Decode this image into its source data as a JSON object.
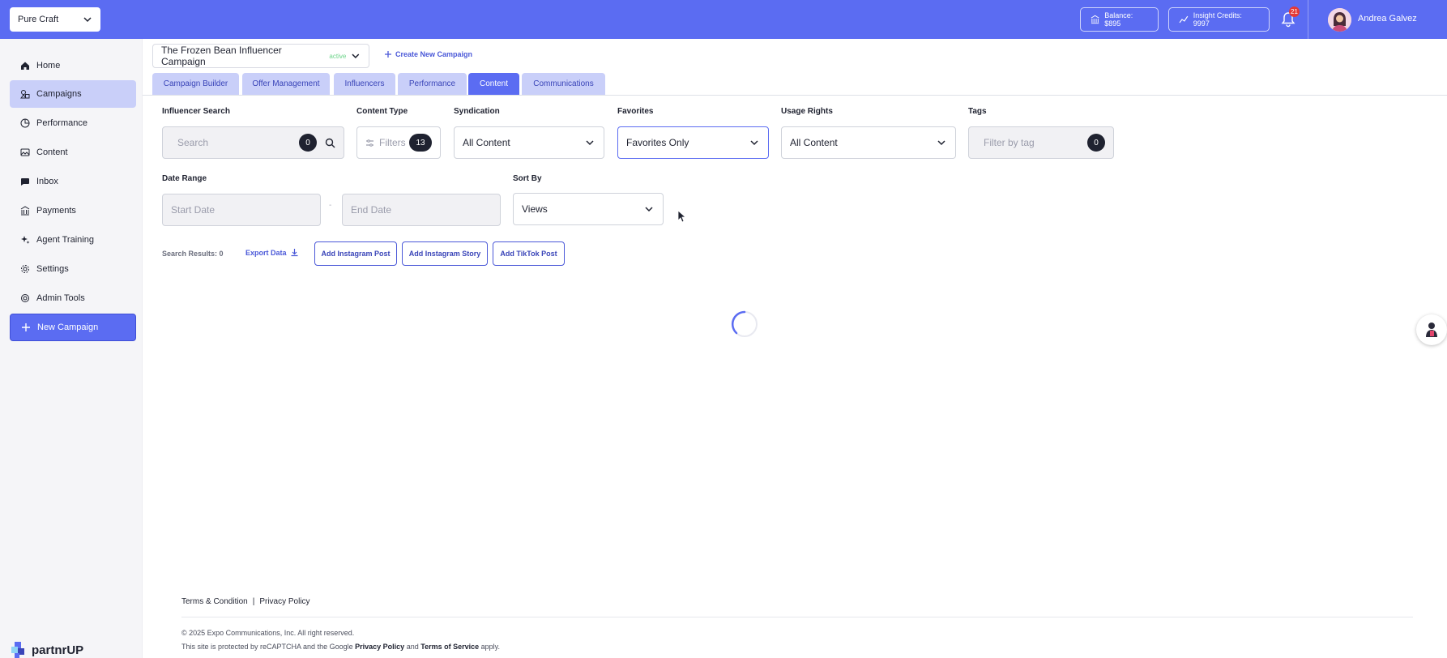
{
  "colors": {
    "primary": "#5b6cf2",
    "tab_inactive": "#c9cff9",
    "sidebar_bg": "#f5f5f8",
    "badge_red": "#e53935",
    "status_green": "#6cd48a"
  },
  "topbar": {
    "org_name": "Pure Craft",
    "balance_label": "Balance: $895",
    "insight_credits_label": "Insight Credits: 9997",
    "notification_count": "21",
    "user_name": "Andrea Galvez"
  },
  "sidebar": {
    "items": [
      {
        "label": "Home",
        "icon": "home-icon"
      },
      {
        "label": "Campaigns",
        "icon": "campaigns-icon"
      },
      {
        "label": "Performance",
        "icon": "chart-pie-icon"
      },
      {
        "label": "Content",
        "icon": "image-icon"
      },
      {
        "label": "Inbox",
        "icon": "chat-icon"
      },
      {
        "label": "Payments",
        "icon": "bank-icon"
      },
      {
        "label": "Agent Training",
        "icon": "sparkle-icon"
      },
      {
        "label": "Settings",
        "icon": "gear-icon"
      },
      {
        "label": "Admin Tools",
        "icon": "admin-gear-icon"
      }
    ],
    "new_campaign_label": "New Campaign",
    "logo_text": "partnrUP"
  },
  "campaign": {
    "name": "The Frozen Bean Influencer Campaign",
    "status": "active",
    "create_label": "Create New Campaign"
  },
  "tabs": [
    {
      "label": "Campaign Builder"
    },
    {
      "label": "Offer Management"
    },
    {
      "label": "Influencers"
    },
    {
      "label": "Performance"
    },
    {
      "label": "Content"
    },
    {
      "label": "Communications"
    }
  ],
  "filters": {
    "influencer_search": {
      "label": "Influencer Search",
      "placeholder": "Search",
      "count": "0"
    },
    "content_type": {
      "label": "Content Type",
      "button_label": "Filters",
      "count": "13"
    },
    "syndication": {
      "label": "Syndication",
      "value": "All Content"
    },
    "favorites": {
      "label": "Favorites",
      "value": "Favorites Only"
    },
    "usage_rights": {
      "label": "Usage Rights",
      "value": "All Content"
    },
    "tags": {
      "label": "Tags",
      "placeholder": "Filter by tag",
      "count": "0"
    },
    "date_range": {
      "label": "Date Range",
      "start_placeholder": "Start Date",
      "end_placeholder": "End Date",
      "separator": "-"
    },
    "sort_by": {
      "label": "Sort By",
      "value": "Views"
    }
  },
  "results": {
    "text": "Search Results: 0",
    "export_label": "Export Data",
    "add_instagram_post": "Add Instagram Post",
    "add_instagram_story": "Add Instagram Story",
    "add_tiktok_post": "Add TikTok Post"
  },
  "footer": {
    "terms": "Terms & Condition",
    "separator": "|",
    "privacy": "Privacy Policy",
    "copyright": "© 2025 Expo Communications, Inc. All right reserved.",
    "recaptcha_prefix": "This site is protected by reCAPTCHA and the Google",
    "recaptcha_privacy": "Privacy Policy",
    "recaptcha_and": "and",
    "recaptcha_terms": "Terms of Service",
    "recaptcha_suffix": "apply."
  }
}
